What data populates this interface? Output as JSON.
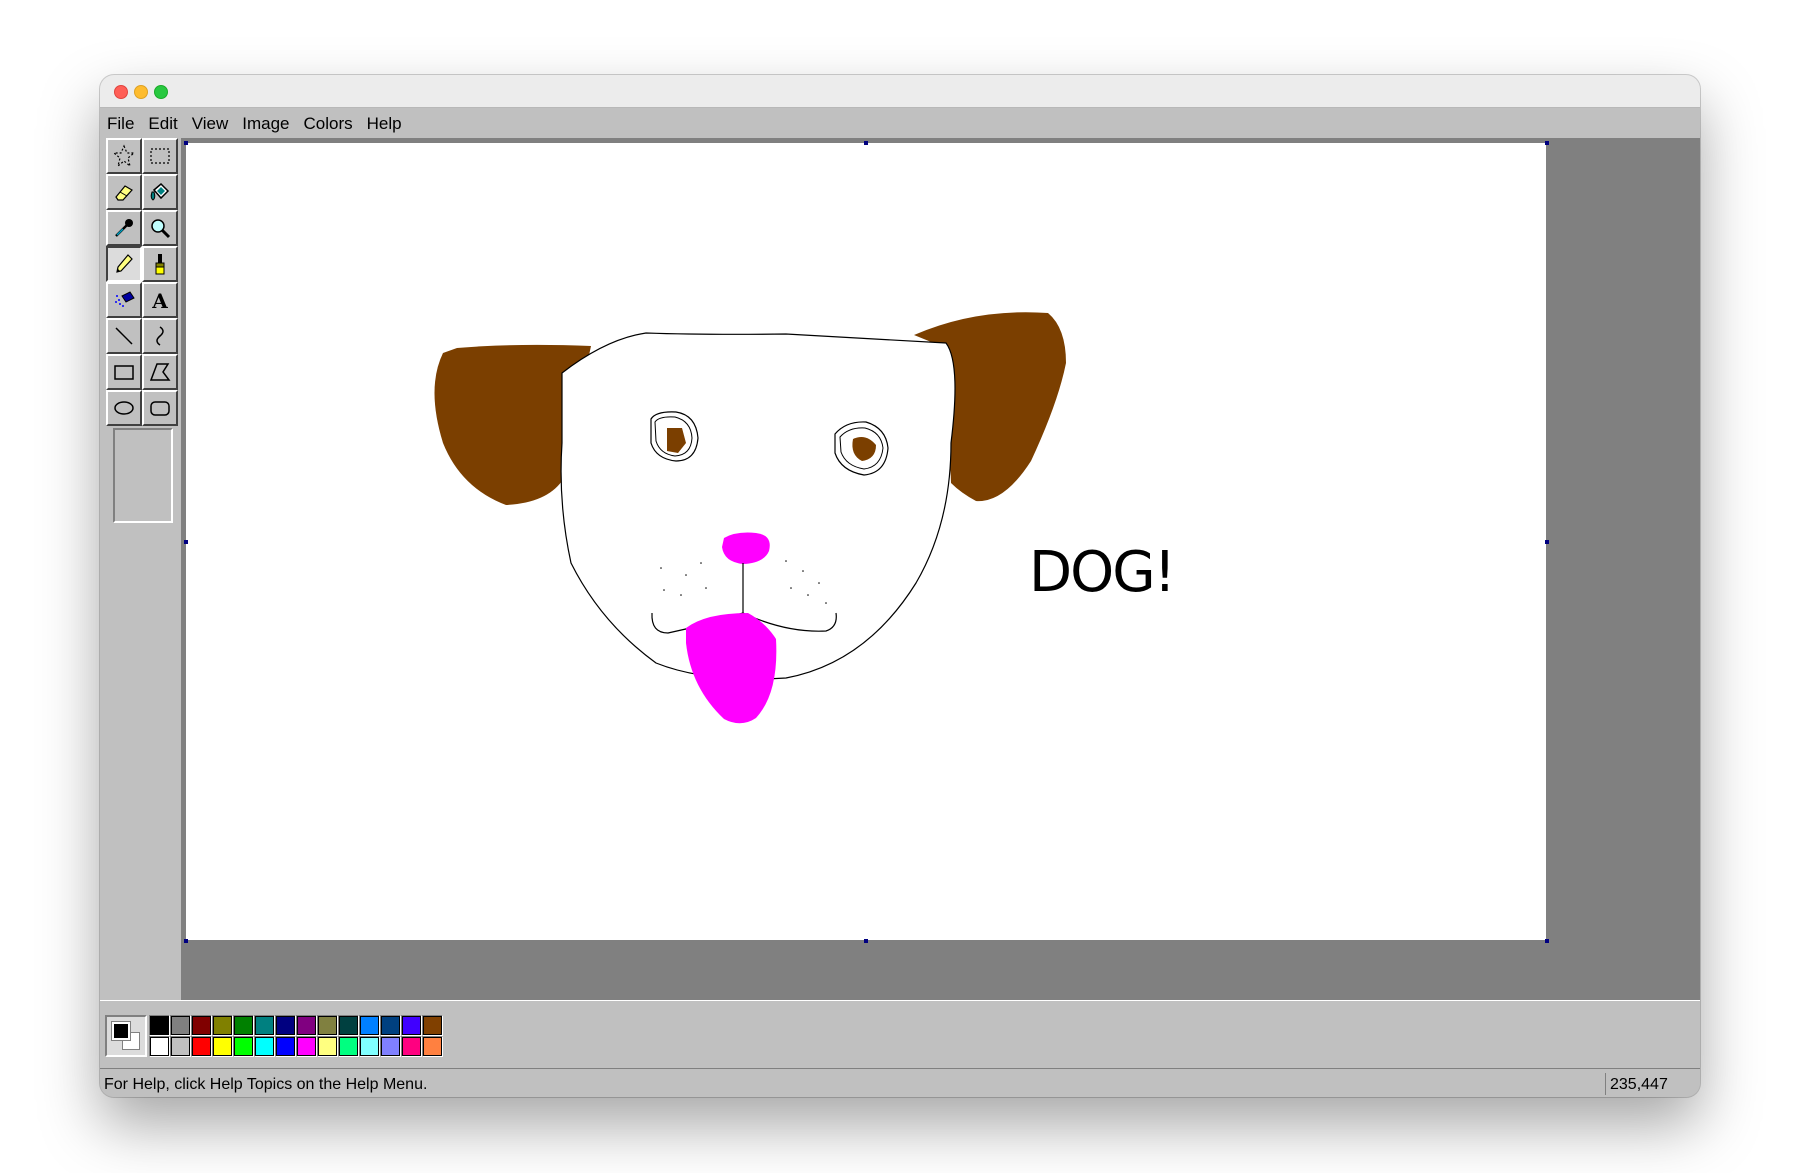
{
  "window": {
    "traffic_lights": [
      "close",
      "minimize",
      "zoom"
    ]
  },
  "menu": [
    "File",
    "Edit",
    "View",
    "Image",
    "Colors",
    "Help"
  ],
  "tools": [
    {
      "name": "free-form-select",
      "icon": "star-select-icon"
    },
    {
      "name": "select",
      "icon": "rect-select-icon"
    },
    {
      "name": "eraser",
      "icon": "eraser-icon"
    },
    {
      "name": "fill-with-color",
      "icon": "paint-bucket-icon"
    },
    {
      "name": "pick-color",
      "icon": "eyedropper-icon"
    },
    {
      "name": "magnifier",
      "icon": "magnifier-icon"
    },
    {
      "name": "pencil",
      "icon": "pencil-icon",
      "active": true
    },
    {
      "name": "brush",
      "icon": "brush-icon"
    },
    {
      "name": "airbrush",
      "icon": "airbrush-icon"
    },
    {
      "name": "text",
      "icon": "text-icon"
    },
    {
      "name": "line",
      "icon": "line-icon"
    },
    {
      "name": "curve",
      "icon": "curve-icon"
    },
    {
      "name": "rectangle",
      "icon": "rectangle-icon"
    },
    {
      "name": "polygon",
      "icon": "polygon-icon"
    },
    {
      "name": "ellipse",
      "icon": "ellipse-icon"
    },
    {
      "name": "rounded-rectangle",
      "icon": "rounded-rectangle-icon"
    }
  ],
  "canvas": {
    "drawing_text": "DOG!",
    "colors": {
      "ear": "#7b3f00",
      "tongue": "#ff00ff",
      "line": "#000000"
    }
  },
  "palette": {
    "foreground": "#000000",
    "background": "#ffffff",
    "top_row": [
      "#000000",
      "#808080",
      "#800000",
      "#808000",
      "#008000",
      "#008080",
      "#000080",
      "#800080",
      "#808040",
      "#004040",
      "#0080ff",
      "#004080",
      "#4000ff",
      "#804000"
    ],
    "bottom_row": [
      "#ffffff",
      "#c0c0c0",
      "#ff0000",
      "#ffff00",
      "#00ff00",
      "#00ffff",
      "#0000ff",
      "#ff00ff",
      "#ffff80",
      "#00ff80",
      "#80ffff",
      "#8080ff",
      "#ff0080",
      "#ff8040"
    ]
  },
  "status": {
    "help_text": "For Help, click Help Topics on the Help Menu.",
    "coordinates": "235,447"
  }
}
